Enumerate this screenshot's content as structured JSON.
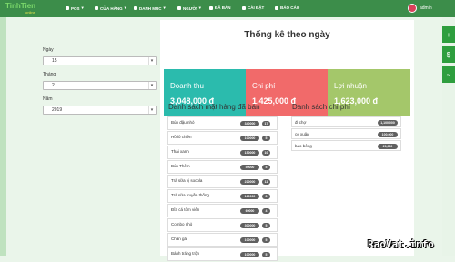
{
  "brand": {
    "name": "TinhTien",
    "sub": "online"
  },
  "nav": [
    {
      "label": "POS",
      "icon": "grid-icon"
    },
    {
      "label": "CỬA HÀNG",
      "icon": "store-icon"
    },
    {
      "label": "DANH MỤC",
      "icon": "list-icon"
    },
    {
      "label": "NGƯỜI",
      "icon": "user-icon"
    },
    {
      "label": "ĐÃ BÁN",
      "icon": "cart-icon"
    },
    {
      "label": "CÀI ĐẶT",
      "icon": "gear-icon"
    },
    {
      "label": "BÁO CÁO",
      "icon": "chart-icon"
    }
  ],
  "user": {
    "name": "admin"
  },
  "filters": {
    "day": {
      "label": "Ngày",
      "value": "15"
    },
    "month": {
      "label": "Tháng",
      "value": "2"
    },
    "year": {
      "label": "Năm",
      "value": "2019"
    }
  },
  "page_title": "Thống kê theo ngày",
  "cards": [
    {
      "label": "Doanh thu",
      "value": "3,048,000 đ",
      "color": "#2bbbad"
    },
    {
      "label": "Chi phí",
      "value": "1,425,000 đ",
      "color": "#f16a6a"
    },
    {
      "label": "Lợi nhuận",
      "value": "1,623,000 đ",
      "color": "#a4c76a"
    }
  ],
  "sold": {
    "title": "Danh sách mặt hàng đã bán",
    "items": [
      {
        "name": "Bún đậu nhỏ",
        "amount": "340000",
        "qty": "17"
      },
      {
        "name": "Hồ lô chiên",
        "amount": "100000",
        "qty": "5"
      },
      {
        "name": "Thái xanh",
        "amount": "150000",
        "qty": "10"
      },
      {
        "name": "Bún Thêm",
        "amount": "50000",
        "qty": "5"
      },
      {
        "name": "Trà sữa vị socola",
        "amount": "220000",
        "qty": "11"
      },
      {
        "name": "Trà sữa truyền thống",
        "amount": "160000",
        "qty": "8"
      },
      {
        "name": "Đĩa cá tôm viên",
        "amount": "60000",
        "qty": "4"
      },
      {
        "name": "Combo nhỏ",
        "amount": "300000",
        "qty": "5"
      },
      {
        "name": "Chân gà",
        "amount": "100000",
        "qty": "5"
      },
      {
        "name": "Bánh tráng trộn",
        "amount": "100000",
        "qty": "5"
      }
    ]
  },
  "costs": {
    "title": "Danh sách chi phí",
    "items": [
      {
        "name": "đi chợ",
        "amount": "1,100,000"
      },
      {
        "name": "cô xuân",
        "amount": "100,000"
      },
      {
        "name": "bao bông",
        "amount": "20,000"
      }
    ]
  },
  "watermark": "RaoVat.info"
}
